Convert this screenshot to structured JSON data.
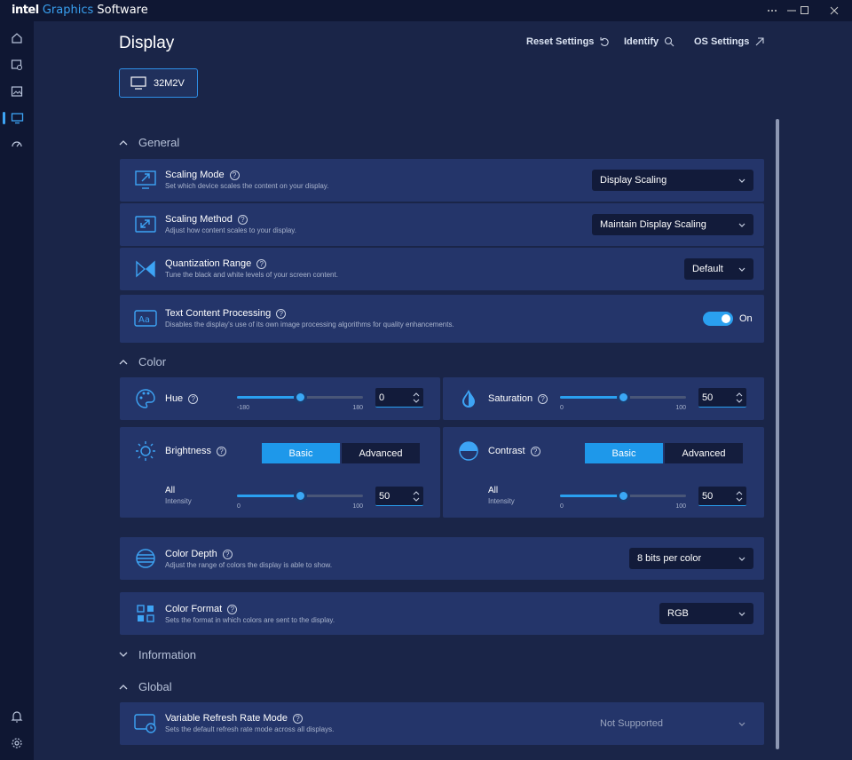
{
  "app": {
    "brand_part1": "intel",
    "brand_part2": "Graphics",
    "brand_part3": "Software"
  },
  "header": {
    "title": "Display",
    "reset": "Reset Settings",
    "identify": "Identify",
    "os_settings": "OS Settings"
  },
  "display_chip": "32M2V",
  "sections": {
    "general": "General",
    "color": "Color",
    "information": "Information",
    "global": "Global"
  },
  "general": [
    {
      "title": "Scaling Mode",
      "desc": "Set which device scales the content on your display.",
      "value": "Display Scaling"
    },
    {
      "title": "Scaling Method",
      "desc": "Adjust how content scales to your display.",
      "value": "Maintain Display Scaling"
    },
    {
      "title": "Quantization Range",
      "desc": "Tune the black and white levels of your screen content.",
      "value": "Default"
    },
    {
      "title": "Text Content Processing",
      "desc": "Disables the display's use of its own image processing algorithms for quality enhancements.",
      "toggle_label": "On",
      "toggle_on": true
    }
  ],
  "color": {
    "hue": {
      "label": "Hue",
      "min": "-180",
      "max": "180",
      "value": "0",
      "fraction": 0.5
    },
    "saturation": {
      "label": "Saturation",
      "min": "0",
      "max": "100",
      "value": "50",
      "fraction": 0.5
    },
    "brightness": {
      "label": "Brightness",
      "basic": "Basic",
      "advanced": "Advanced",
      "row_label": "All",
      "row_sub": "Intensity",
      "min": "0",
      "max": "100",
      "value": "50",
      "fraction": 0.5
    },
    "contrast": {
      "label": "Contrast",
      "basic": "Basic",
      "advanced": "Advanced",
      "row_label": "All",
      "row_sub": "Intensity",
      "min": "0",
      "max": "100",
      "value": "50",
      "fraction": 0.5
    },
    "depth": {
      "title": "Color Depth",
      "desc": "Adjust the range of colors the display is able to show.",
      "value": "8 bits per color"
    },
    "format": {
      "title": "Color Format",
      "desc": "Sets the format in which colors are sent to the display.",
      "value": "RGB"
    }
  },
  "global": {
    "vrr": {
      "title": "Variable Refresh Rate Mode",
      "desc": "Sets the default refresh rate mode across all displays.",
      "value": "Not Supported"
    }
  },
  "colors": {
    "accent": "#1e98ea",
    "background": "#1a2548",
    "card": "#24356a",
    "sidebar": "#0f1733"
  }
}
